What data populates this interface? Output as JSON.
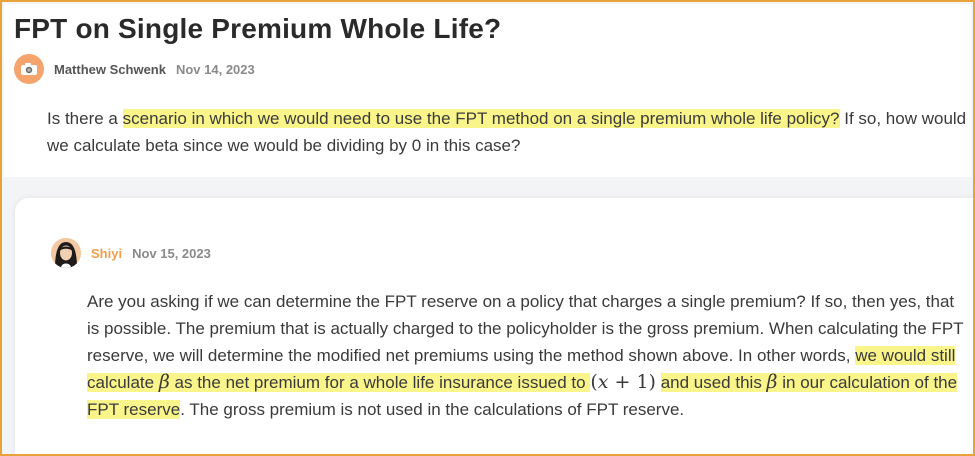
{
  "question": {
    "title": "FPT on Single Premium Whole Life?",
    "author": "Matthew Schwenk",
    "date": "Nov 14, 2023",
    "body_pre": "Is there a ",
    "body_highlight": "scenario in which we would need to use the FPT method on a single premium whole life policy?",
    "body_post": " If so, how would we calculate beta since we would be dividing by 0 in this case?"
  },
  "answer": {
    "author": "Shiyi",
    "date": "Nov 15, 2023",
    "text_1": "Are you asking if we can determine the FPT reserve on a policy that charges a single premium? If so, then yes, that is possible. The premium that is actually charged to the policyholder is the gross premium. When calculating the FPT reserve, we will determine the modified net premiums using the method shown above. In other words, ",
    "hl_1": "we would still calculate ",
    "beta_1": "β",
    "hl_2": " as the net premium for a whole life insurance issued to ",
    "math_open": "(",
    "math_x": "x",
    "math_plus": " + 1)",
    "hl_3": "and used this ",
    "beta_2": "β",
    "hl_4": " in our calculation of the FPT reserve",
    "text_2": ". The gross premium is not used in the calculations of FPT reserve."
  },
  "icons": {
    "question_avatar": "camera-icon",
    "answer_avatar": "person-avatar"
  },
  "colors": {
    "border": "#e8a23a",
    "highlight": "#faf58a",
    "accent_author": "#f0a04b"
  }
}
